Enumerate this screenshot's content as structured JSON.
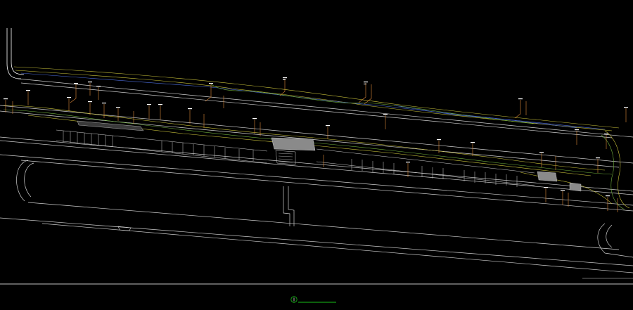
{
  "drawing": {
    "title_block": {
      "caption": "",
      "number": ""
    },
    "colors": {
      "background": "#000000",
      "linework": "#cfcfcf",
      "road_edge": "#ffffff",
      "contour_yellow": "#c9c23a",
      "contour_green": "#6fae3c",
      "contour_blue": "#4c6cd9",
      "label_leader": "#e08a3a",
      "label_text": "#ffffff",
      "platform_fill": "#8a8a8a",
      "caption_line": "#19c119"
    },
    "icons": [
      "north-arrow-circle-icon"
    ]
  }
}
